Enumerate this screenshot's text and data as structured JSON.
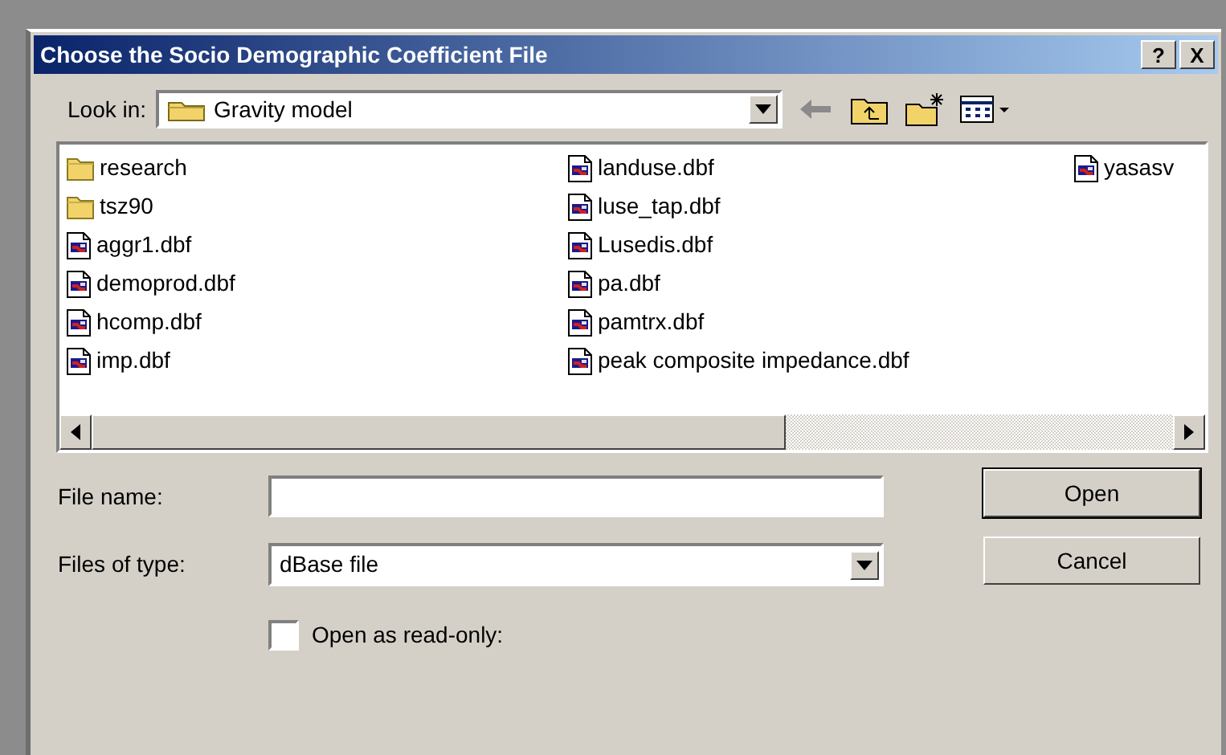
{
  "window": {
    "title": "Choose the Socio Demographic Coefficient File",
    "title_buttons": [
      "?",
      "X"
    ]
  },
  "look_in": {
    "label": "Look in:",
    "value": "Gravity model"
  },
  "toolbar": {
    "back_disabled": true
  },
  "file_columns": [
    [
      {
        "kind": "folder",
        "name": "research"
      },
      {
        "kind": "folder",
        "name": "tsz90"
      },
      {
        "kind": "file",
        "name": "aggr1.dbf"
      },
      {
        "kind": "file",
        "name": "demoprod.dbf"
      },
      {
        "kind": "file",
        "name": "hcomp.dbf"
      },
      {
        "kind": "file",
        "name": "imp.dbf"
      }
    ],
    [
      {
        "kind": "file",
        "name": "landuse.dbf"
      },
      {
        "kind": "file",
        "name": "luse_tap.dbf"
      },
      {
        "kind": "file",
        "name": "Lusedis.dbf"
      },
      {
        "kind": "file",
        "name": "pa.dbf"
      },
      {
        "kind": "file",
        "name": "pamtrx.dbf"
      },
      {
        "kind": "file",
        "name": "peak composite impedance.dbf"
      }
    ],
    [
      {
        "kind": "file",
        "name": "yasasv"
      }
    ]
  ],
  "file_name": {
    "label": "File name:"
  },
  "file_type": {
    "label": "Files of type:",
    "value": "dBase file"
  },
  "read_only": {
    "label": "Open as read-only:",
    "checked": false
  },
  "buttons": [
    {
      "label": "Open",
      "default": true
    },
    {
      "label": "Cancel",
      "default": false
    }
  ]
}
